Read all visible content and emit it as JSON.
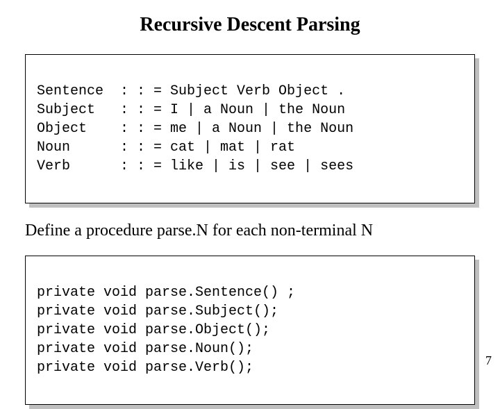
{
  "title": "Recursive Descent Parsing",
  "grammar": [
    "Sentence  : : = Subject Verb Object .",
    "Subject   : : = I | a Noun | the Noun",
    "Object    : : = me | a Noun | the Noun",
    "Noun      : : = cat | mat | rat",
    "Verb      : : = like | is | see | sees"
  ],
  "body_text": "Define a procedure parse.N for each non-terminal N",
  "code": [
    "private void parse.Sentence() ;",
    "private void parse.Subject();",
    "private void parse.Object();",
    "private void parse.Noun();",
    "private void parse.Verb();"
  ],
  "page_number": "7"
}
